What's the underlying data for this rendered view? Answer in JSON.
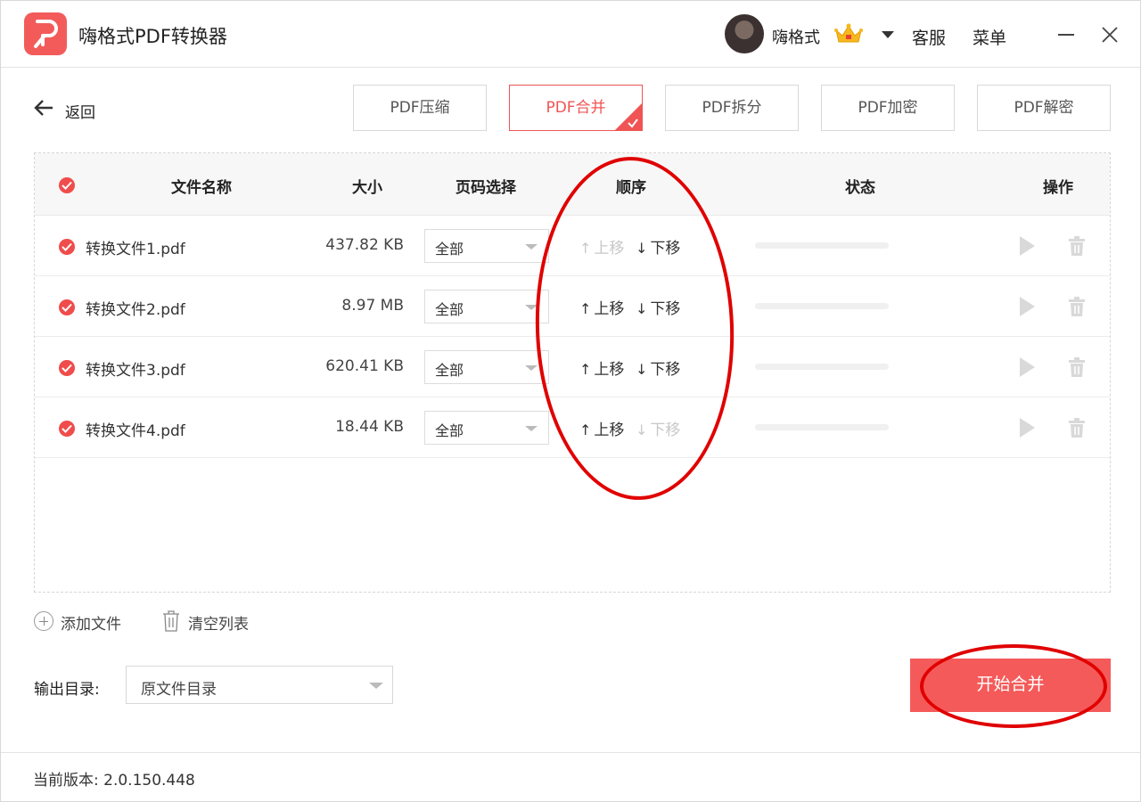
{
  "app": {
    "title": "嗨格式PDF转换器",
    "username": "嗨格式",
    "service": "客服",
    "menu": "菜单"
  },
  "toolbar": {
    "back_label": "返回",
    "tabs": [
      {
        "label": "PDF压缩",
        "active": false
      },
      {
        "label": "PDF合并",
        "active": true
      },
      {
        "label": "PDF拆分",
        "active": false
      },
      {
        "label": "PDF加密",
        "active": false
      },
      {
        "label": "PDF解密",
        "active": false
      }
    ]
  },
  "table": {
    "headers": {
      "name": "文件名称",
      "size": "大小",
      "pages": "页码选择",
      "order": "顺序",
      "status": "状态",
      "action": "操作"
    },
    "move_up": "上移",
    "move_down": "下移",
    "rows": [
      {
        "name": "转换文件1.pdf",
        "size": "437.82 KB",
        "pages": "全部",
        "up_enabled": false,
        "down_enabled": true,
        "progress": 0
      },
      {
        "name": "转换文件2.pdf",
        "size": "8.97 MB",
        "pages": "全部",
        "up_enabled": true,
        "down_enabled": true,
        "progress": 0
      },
      {
        "name": "转换文件3.pdf",
        "size": "620.41 KB",
        "pages": "全部",
        "up_enabled": true,
        "down_enabled": true,
        "progress": 0
      },
      {
        "name": "转换文件4.pdf",
        "size": "18.44 KB",
        "pages": "全部",
        "up_enabled": true,
        "down_enabled": false,
        "progress": 0
      }
    ]
  },
  "bottom": {
    "add_file": "添加文件",
    "clear_list": "清空列表",
    "output_label": "输出目录:",
    "output_value": "原文件目录",
    "start_button": "开始合并"
  },
  "footer": {
    "version": "当前版本: 2.0.150.448"
  },
  "colors": {
    "accent": "#f05454",
    "annotation": "#e00000"
  }
}
